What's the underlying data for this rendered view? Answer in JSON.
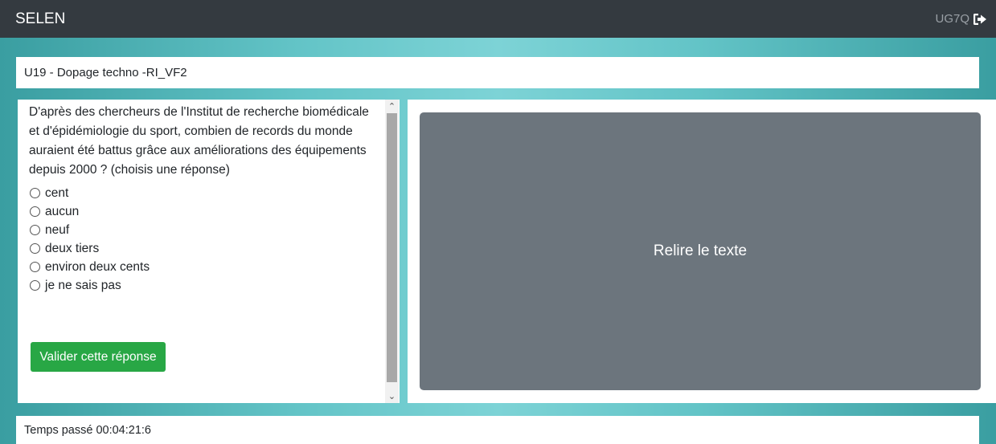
{
  "navbar": {
    "brand": "SELEN",
    "user_code": "UG7Q",
    "logout_icon": "sign-out-icon"
  },
  "exercise": {
    "title": "U19 - Dopage techno -RI_VF2"
  },
  "question": {
    "text": "D'après des chercheurs de l'Institut de recherche biomédicale et d'épidémiologie du sport, combien de records du monde auraient été battus grâce aux améliorations des équipements depuis 2000 ? (choisis une réponse)",
    "options": [
      "cent",
      "aucun",
      "neuf",
      "deux tiers",
      "environ deux cents",
      "je ne sais pas"
    ],
    "submit_label": "Valider cette réponse"
  },
  "text_panel": {
    "reread_label": "Relire le texte"
  },
  "footer": {
    "elapsed": "Temps passé 00:04:21:6"
  },
  "colors": {
    "navbar_bg": "#343a40",
    "primary_success": "#28a745",
    "secondary": "#6c757d",
    "teal_background": "#63c4c7"
  }
}
